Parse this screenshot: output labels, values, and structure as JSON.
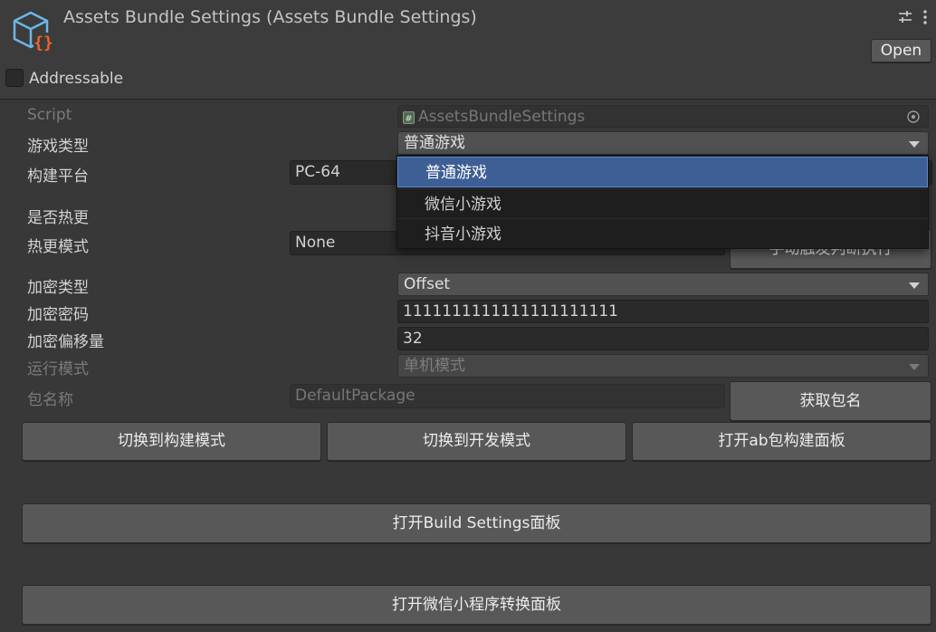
{
  "window": {
    "title": "Assets Bundle Settings (Assets Bundle Settings)",
    "open_label": "Open",
    "addressable_label": "Addressable",
    "addressable_checked": false
  },
  "fields": {
    "script": {
      "label": "Script",
      "value": "AssetsBundleSettings"
    },
    "game_type": {
      "label": "游戏类型",
      "value": "普通游戏"
    },
    "build_platform": {
      "label": "构建平台",
      "value": "PC-64"
    },
    "hot_update": {
      "label": "是否热更"
    },
    "hot_update_mode": {
      "label": "热更模式",
      "value": "None"
    },
    "manual_button": "手动触发判断执行",
    "encrypt_type": {
      "label": "加密类型",
      "value": "Offset"
    },
    "encrypt_password": {
      "label": "加密密码",
      "value": "1111111111111111111111"
    },
    "encrypt_offset": {
      "label": "加密偏移量",
      "value": "32"
    },
    "run_mode": {
      "label": "运行模式",
      "value": "单机模式"
    },
    "package_name": {
      "label": "包名称",
      "value": "DefaultPackage"
    },
    "get_package_button": "获取包名"
  },
  "buttons": {
    "switch_build": "切换到构建模式",
    "switch_dev": "切换到开发模式",
    "open_ab": "打开ab包构建面板",
    "open_build_settings": "打开Build Settings面板",
    "open_wechat": "打开微信小程序转换面板"
  },
  "game_type_menu": {
    "options": [
      "普通游戏",
      "微信小游戏",
      "抖音小游戏"
    ],
    "selected": "普通游戏"
  },
  "icons": [
    "settings-asset-icon",
    "adjust-icon",
    "kebab-menu-icon",
    "script-icon",
    "object-picker-icon",
    "dropdown-arrow-icon"
  ],
  "colors": {
    "background": "#383838",
    "selection": "#3e5f96",
    "button": "#585858",
    "field": "#2a2a2a",
    "icon_blue": "#6bb8e8",
    "icon_orange": "#f0642c"
  }
}
